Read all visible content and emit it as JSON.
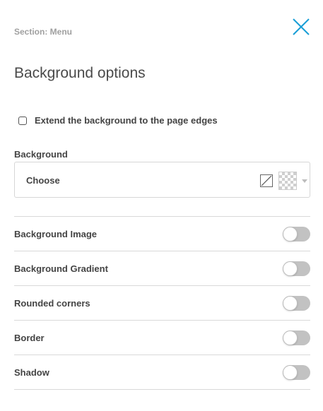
{
  "header": {
    "section_label": "Section: Menu",
    "title": "Background options",
    "close_icon": "close-icon",
    "accent_color": "#1a9fd6"
  },
  "extend_background": {
    "label": "Extend the background to the page edges",
    "checked": false
  },
  "background": {
    "label": "Background",
    "value": "Choose",
    "icons": [
      "no-color-icon",
      "transparent-swatch-icon",
      "chevron-down-icon"
    ]
  },
  "options": [
    {
      "label": "Background Image",
      "enabled": false
    },
    {
      "label": "Background Gradient",
      "enabled": false
    },
    {
      "label": "Rounded corners",
      "enabled": false
    },
    {
      "label": "Border",
      "enabled": false
    },
    {
      "label": "Shadow",
      "enabled": false
    }
  ]
}
